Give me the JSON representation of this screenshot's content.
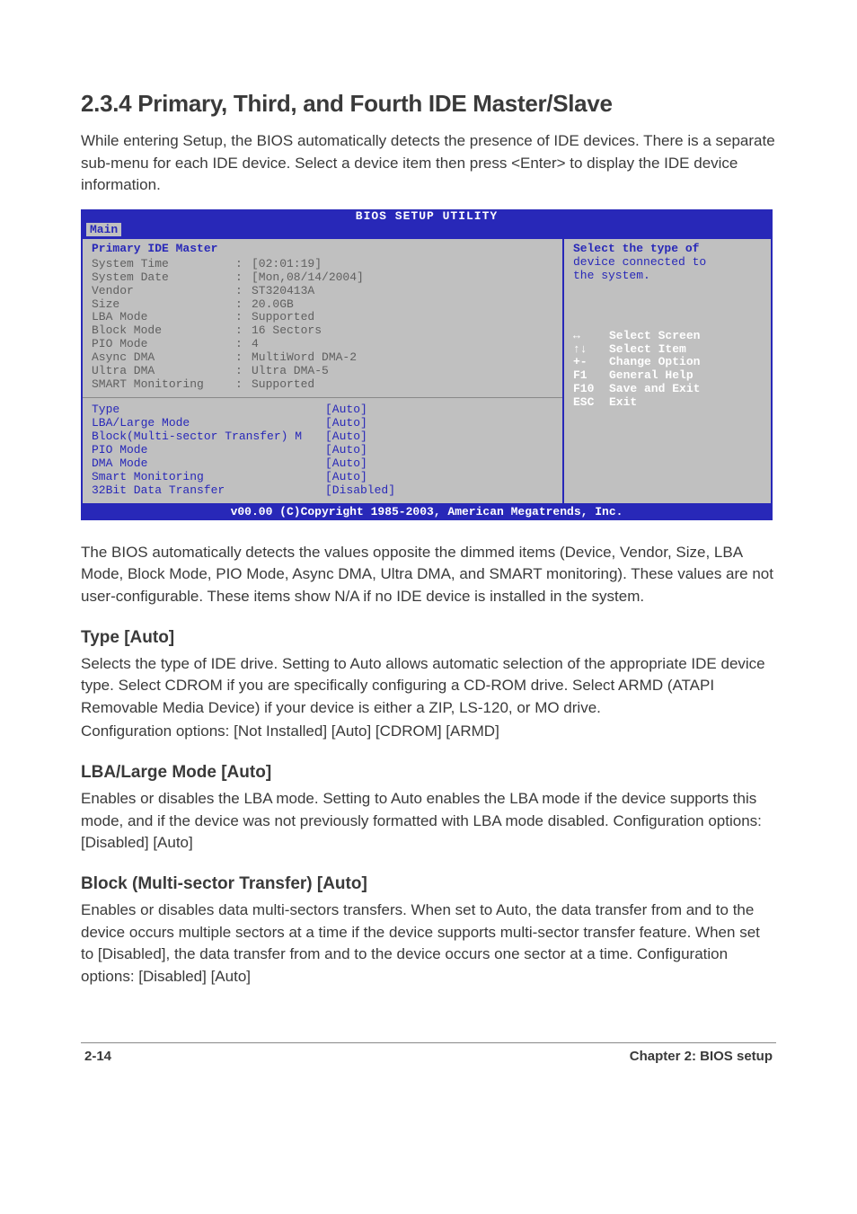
{
  "section": {
    "number_title": "2.3.4  Primary, Third, and Fourth IDE Master/Slave",
    "intro": "While entering Setup, the BIOS automatically detects the presence of IDE devices. There is a separate sub-menu for each IDE device. Select a device item then press <Enter> to display the IDE device information."
  },
  "bios": {
    "title": "BIOS SETUP UTILITY",
    "tab_active": "Main",
    "panel_title": "Primary IDE Master",
    "detected": [
      {
        "label": "System Time",
        "value": "[02:01:19]"
      },
      {
        "label": "System Date",
        "value": "[Mon,08/14/2004]"
      },
      {
        "label": "Vendor",
        "value": "ST320413A"
      },
      {
        "label": "Size",
        "value": "20.0GB"
      },
      {
        "label": "LBA Mode",
        "value": "Supported"
      },
      {
        "label": "Block Mode",
        "value": "16 Sectors"
      },
      {
        "label": "PIO Mode",
        "value": "4"
      },
      {
        "label": "Async DMA",
        "value": "MultiWord DMA-2"
      },
      {
        "label": "Ultra DMA",
        "value": "Ultra DMA-5"
      },
      {
        "label": "SMART Monitoring",
        "value": "Supported"
      }
    ],
    "options": [
      {
        "label": "Type",
        "value": "[Auto]"
      },
      {
        "label": "LBA/Large Mode",
        "value": "[Auto]"
      },
      {
        "label": "Block(Multi-sector Transfer) M",
        "value": "[Auto]"
      },
      {
        "label": "PIO Mode",
        "value": "[Auto]"
      },
      {
        "label": "DMA Mode",
        "value": "[Auto]"
      },
      {
        "label": "Smart Monitoring",
        "value": "[Auto]"
      },
      {
        "label": "32Bit Data Transfer",
        "value": "[Disabled]"
      }
    ],
    "help_text_line1": "Select the type of",
    "help_text_line2": "device connected to",
    "help_text_line3": "the system.",
    "nav": [
      {
        "key": "↔",
        "desc": "Select Screen"
      },
      {
        "key": "↑↓",
        "desc": "Select Item"
      },
      {
        "key": "+-",
        "desc": "Change Option"
      },
      {
        "key": "F1",
        "desc": "General Help"
      },
      {
        "key": "F10",
        "desc": "Save and Exit"
      },
      {
        "key": "ESC",
        "desc": "Exit"
      }
    ],
    "footer": "v00.00 (C)Copyright 1985-2003, American Megatrends, Inc."
  },
  "after_bios": "The BIOS automatically detects the values opposite the dimmed items (Device, Vendor, Size, LBA Mode, Block Mode, PIO Mode, Async DMA, Ultra DMA, and SMART monitoring). These values are not user-configurable. These items show N/A if no IDE device is installed in the system.",
  "type": {
    "heading": "Type [Auto]",
    "p1": "Selects the type of IDE drive. Setting to Auto allows automatic selection of the appropriate IDE device type. Select CDROM if you are specifically configuring a CD-ROM drive. Select ARMD (ATAPI Removable Media Device) if your device is either a ZIP, LS-120, or MO drive.",
    "p2": "Configuration options: [Not Installed] [Auto] [CDROM] [ARMD]"
  },
  "lba": {
    "heading": "LBA/Large Mode [Auto]",
    "p": "Enables or disables the LBA mode. Setting to Auto enables the LBA mode if the device supports this mode, and if the device was not previously formatted with LBA mode disabled. Configuration options: [Disabled] [Auto]"
  },
  "block": {
    "heading": "Block (Multi-sector Transfer) [Auto]",
    "p": "Enables or disables data multi-sectors transfers. When set to Auto, the data transfer from and to the device occurs multiple sectors at a time if the device supports multi-sector transfer feature. When set to [Disabled], the data transfer from and to the device occurs one sector at a time. Configuration options: [Disabled] [Auto]"
  },
  "footer": {
    "left": "2-14",
    "right": "Chapter 2: BIOS setup"
  }
}
